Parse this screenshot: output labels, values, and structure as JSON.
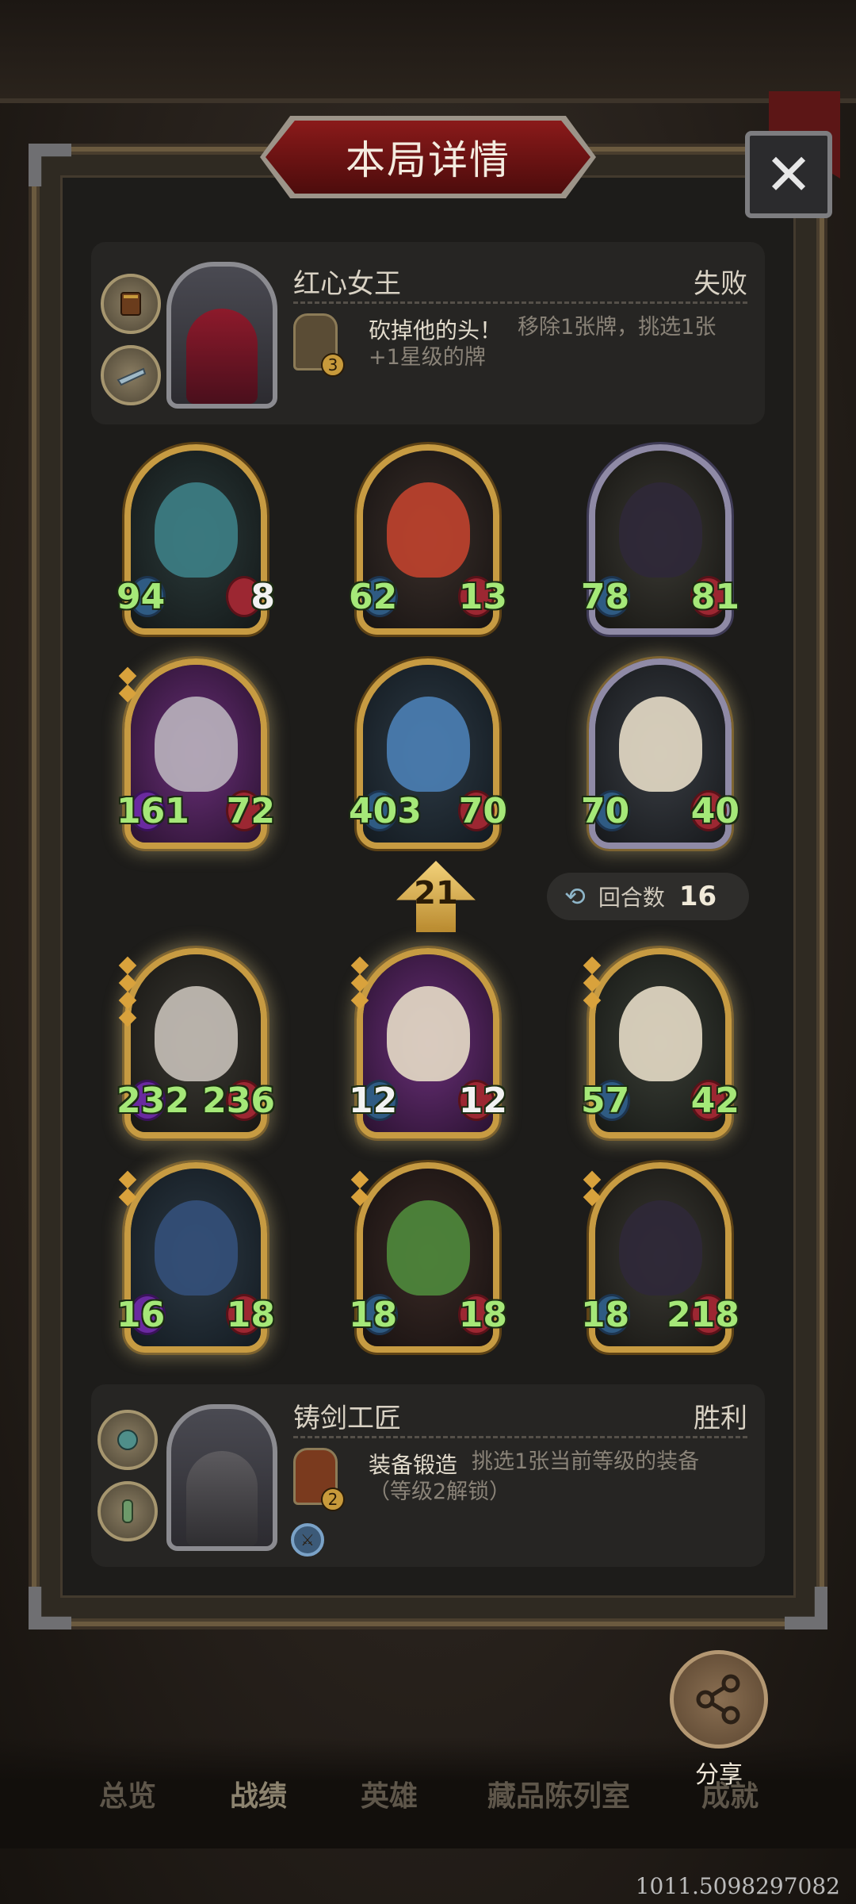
{
  "dialog": {
    "title": "本局详情",
    "close_icon": "✕"
  },
  "opponent": {
    "name": "红心女王",
    "result": "失败",
    "skill_title": "砍掉他的头！",
    "skill_desc_line1": "移除1张牌，挑选1张",
    "skill_desc_line2": "+1星级的牌",
    "skill_level": "3"
  },
  "player": {
    "name": "铸剑工匠",
    "result": "胜利",
    "skill_title": "装备锻造",
    "skill_desc_line1": "挑选1张当前等级的装备",
    "skill_desc_line2": "（等级2解锁）",
    "skill_level": "2"
  },
  "opponent_board": [
    {
      "attack": "94",
      "health": "8"
    },
    {
      "attack": "62",
      "health": "13"
    },
    {
      "attack": "78",
      "health": "81"
    },
    {
      "attack": "161",
      "health": "72"
    },
    {
      "attack": "403",
      "health": "70"
    },
    {
      "attack": "70",
      "health": "40"
    }
  ],
  "player_board": [
    {
      "attack": "232",
      "health": "236"
    },
    {
      "attack": "12",
      "health": "12"
    },
    {
      "attack": "57",
      "health": "42"
    },
    {
      "attack": "16",
      "health": "18"
    },
    {
      "attack": "18",
      "health": "18"
    },
    {
      "attack": "18",
      "health": "218"
    }
  ],
  "turn": {
    "arrow_value": "21",
    "round_label": "回合数",
    "round_value": "16"
  },
  "share": {
    "label": "分享",
    "icon": "share-icon"
  },
  "nav": [
    "总览",
    "战绩",
    "英雄",
    "藏品陈列室",
    "成就"
  ],
  "coordinate_text": "1011.5098297082"
}
